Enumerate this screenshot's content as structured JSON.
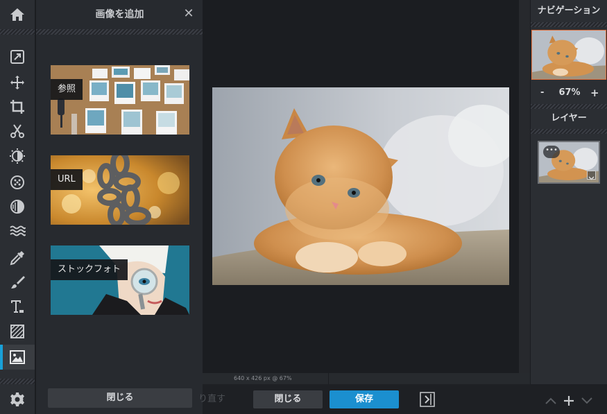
{
  "toolbar": {
    "tools": [
      {
        "icon": "home-icon"
      },
      {
        "icon": "adjust-icon"
      },
      {
        "icon": "move-icon"
      },
      {
        "icon": "crop-icon"
      },
      {
        "icon": "cut-icon"
      },
      {
        "icon": "brightness-icon"
      },
      {
        "icon": "filter-icon"
      },
      {
        "icon": "contrast-icon"
      },
      {
        "icon": "wave-icon"
      },
      {
        "icon": "eyedropper-icon"
      },
      {
        "icon": "brush-icon"
      },
      {
        "icon": "text-icon"
      },
      {
        "icon": "texture-icon"
      },
      {
        "icon": "image-icon"
      },
      {
        "icon": "gear-icon"
      }
    ],
    "active_tool": "image-icon"
  },
  "add_image_panel": {
    "title": "画像を追加",
    "close_glyph": "✕",
    "sources": [
      {
        "label": "参照"
      },
      {
        "label": "URL"
      },
      {
        "label": "ストックフォト"
      }
    ],
    "close_button": "閉じる"
  },
  "canvas": {
    "status_text": "640 x 426 px @ 67%"
  },
  "bottom_bar": {
    "redo_label": "り直す",
    "close_label": "閉じる",
    "save_label": "保存"
  },
  "navigation": {
    "title": "ナビゲーション",
    "zoom_minus": "-",
    "zoom_value": "67%",
    "zoom_plus": "+"
  },
  "layers": {
    "title": "レイヤー",
    "options_glyph": "•••",
    "controls": [
      "chevron-up-icon",
      "plus-icon",
      "chevron-down-icon"
    ]
  },
  "colors": {
    "accent": "#1b8fcf",
    "active_indicator": "#19a0d8",
    "nav_highlight": "#e06d3a"
  }
}
